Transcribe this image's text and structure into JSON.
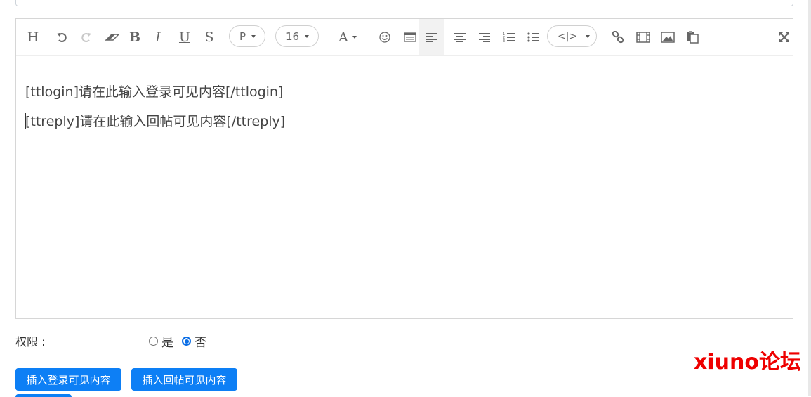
{
  "toolbar": {
    "heading": "H",
    "bold": "B",
    "italic": "I",
    "underline": "U",
    "strike": "S",
    "paragraph_value": "P",
    "font_size_value": "16",
    "font_color": "A",
    "code_value": "<|>",
    "icons": [
      "heading-icon",
      "undo-icon",
      "redo-icon",
      "eraser-icon",
      "bold-icon",
      "italic-icon",
      "underline-icon",
      "strikethrough-icon",
      "paragraph-select",
      "font-size-select",
      "font-color-icon",
      "emoji-icon",
      "table-icon",
      "align-left-icon",
      "align-center-icon",
      "align-right-icon",
      "ordered-list-icon",
      "unordered-list-icon",
      "code-select",
      "link-icon",
      "video-icon",
      "image-icon",
      "paste-icon",
      "fullscreen-icon"
    ]
  },
  "editor": {
    "lines": [
      "[ttlogin]请在此输入登录可见内容[/ttlogin]",
      "[ttreply]请在此输入回帖可见内容[/ttreply]"
    ]
  },
  "permission": {
    "label": "权限 :",
    "options": [
      "是",
      "否"
    ],
    "selected": "否"
  },
  "buttons": {
    "insert_login": "插入登录可见内容",
    "insert_reply": "插入回帖可见内容"
  },
  "watermark": "xiuno论坛",
  "colors": {
    "primary_button": "#0d7ff5",
    "watermark": "#ee0000",
    "radio_checked": "#0a6ee6"
  }
}
